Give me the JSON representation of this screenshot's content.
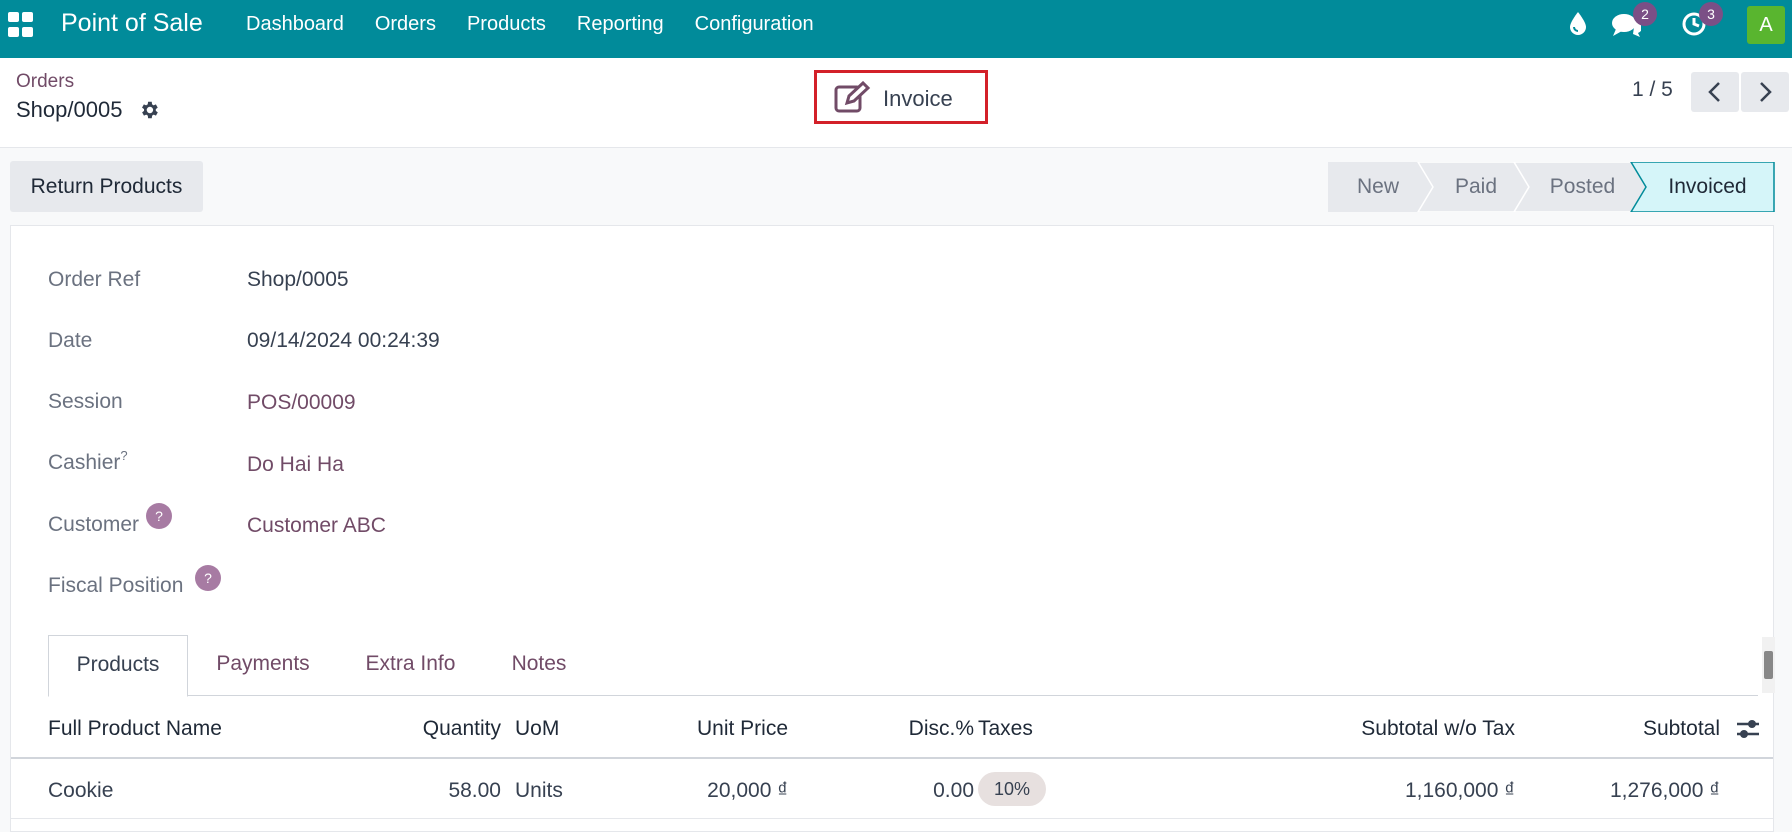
{
  "navbar": {
    "brand": "Point of Sale",
    "menu": [
      "Dashboard",
      "Orders",
      "Products",
      "Reporting",
      "Configuration"
    ],
    "messages_count": "2",
    "activities_count": "3",
    "avatar_letter": "A",
    "bg_color": "#018b9a"
  },
  "control": {
    "breadcrumb": "Orders",
    "record_title": "Shop/0005",
    "invoice_label": "Invoice",
    "pager": "1 / 5"
  },
  "actions": {
    "return_products": "Return Products"
  },
  "statusbar": {
    "stages": [
      "New",
      "Paid",
      "Posted",
      "Invoiced"
    ],
    "current": "Invoiced"
  },
  "form": {
    "order_ref_label": "Order Ref",
    "order_ref": "Shop/0005",
    "date_label": "Date",
    "date": "09/14/2024 00:24:39",
    "session_label": "Session",
    "session": "POS/00009",
    "cashier_label": "Cashier",
    "cashier_sup": "?",
    "cashier": "Do Hai Ha",
    "customer_label": "Customer",
    "customer": "Customer ABC",
    "fiscal_position_label": "Fiscal Position",
    "help_mark": "?"
  },
  "tabs": [
    "Products",
    "Payments",
    "Extra Info",
    "Notes"
  ],
  "table": {
    "columns": [
      "Full Product Name",
      "Quantity",
      "UoM",
      "Unit Price",
      "Disc.%",
      "Taxes",
      "Subtotal w/o Tax",
      "Subtotal"
    ],
    "rows": [
      {
        "product": "Cookie",
        "quantity": "58.00",
        "uom": "Units",
        "unit_price": "20,000 ₫",
        "discount": "0.00",
        "taxes": "10%",
        "subtotal_wo_tax": "1,160,000 ₫",
        "subtotal": "1,276,000 ₫"
      }
    ]
  }
}
